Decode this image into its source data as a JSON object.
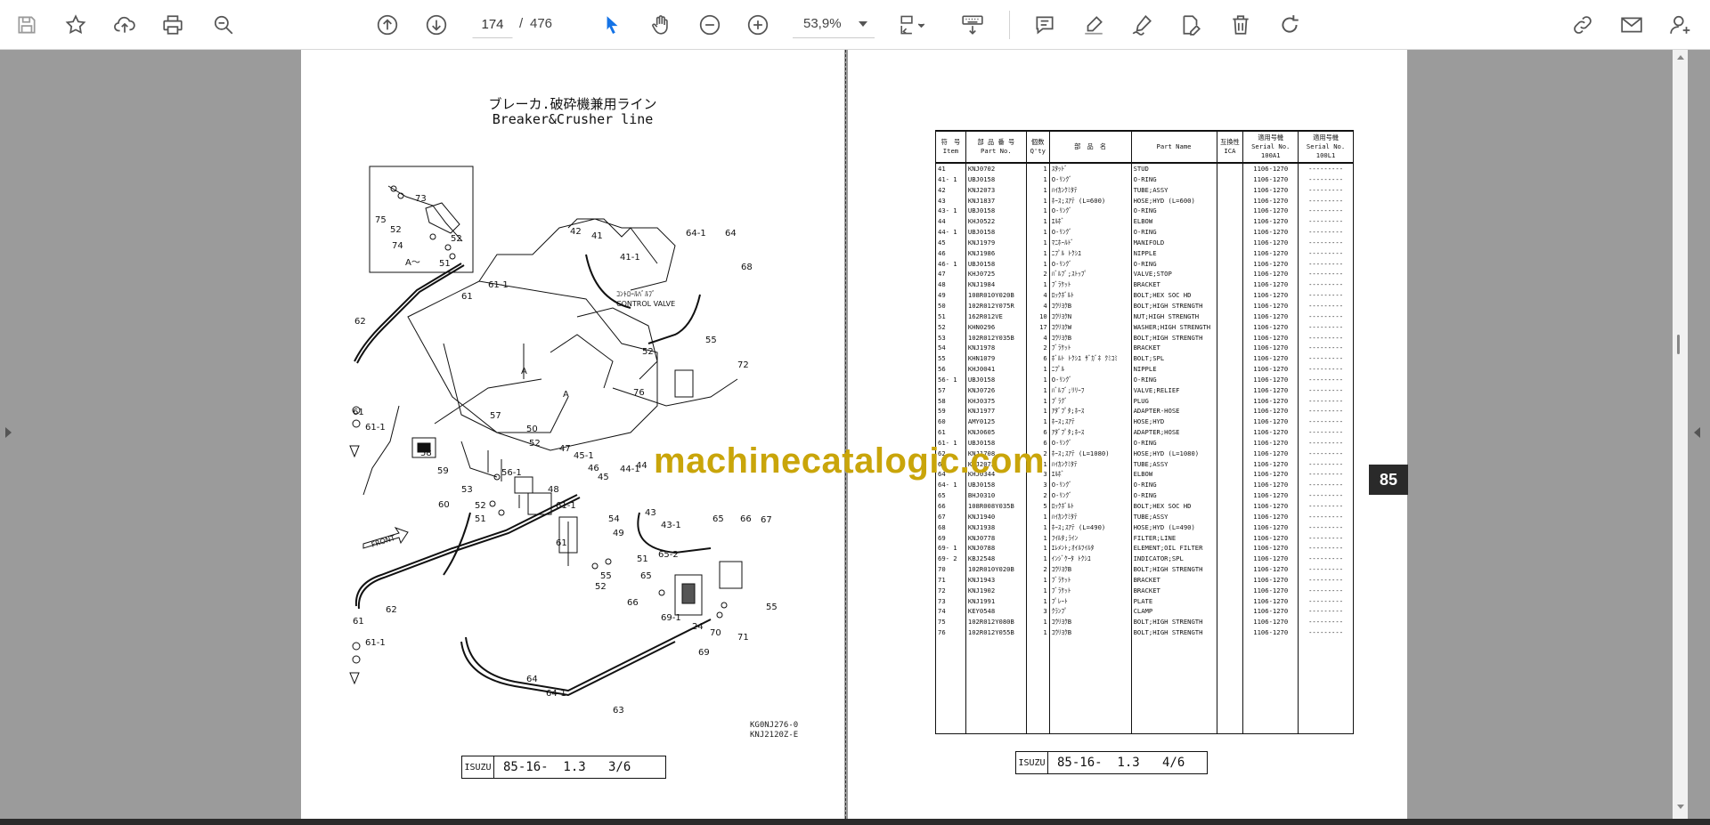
{
  "toolbar": {
    "page_current": "174",
    "page_separator": "/",
    "page_total": "476",
    "zoom": "53,9%",
    "accent_color": "#1473e6"
  },
  "left_page": {
    "title_jp": "ブレーカ.破砕機兼用ライン",
    "title_en": "Breaker&Crusher line",
    "control_valve_jp": "ｺﾝﾄﾛｰﾙﾊﾞﾙﾌﾞ",
    "control_valve_en": "CONTROL VALVE",
    "inset_label": "A～",
    "front_label": "FRONT",
    "ref_code_1": "KG0NJ276-0",
    "ref_code_2": "KNJ2120Z-E",
    "footer_logo": "ISUZU",
    "footer_text": "85-16-  1.3   3/6"
  },
  "right_page": {
    "headers": {
      "item_jp": "符　号",
      "item_en": "Item",
      "pn_jp": "部 品 番 号",
      "pn_en": "Part No.",
      "qty_jp": "個数",
      "qty_en": "Q'ty",
      "name_jp": "部　品　名",
      "name_en": "Part Name",
      "ica_jp": "互換性",
      "ica_en": "ICA",
      "s1_jp": "適用号機",
      "s1_en": "Serial No.",
      "s1_code": "100A1",
      "s2_jp": "適用号機",
      "s2_en": "Serial No.",
      "s2_code": "100L1"
    },
    "rows": [
      [
        "41",
        "KNJ0702",
        "1",
        "ｽﾀｯﾄﾞ",
        "STUD",
        "",
        "1106-1270",
        "---------"
      ],
      [
        "41- 1",
        "UBJ0158",
        "1",
        "O-ﾘﾝｸﾞ",
        "O-RING",
        "",
        "1106-1270",
        "---------"
      ],
      [
        "42",
        "KNJ2073",
        "1",
        "ﾊｲｶﾝｸﾐﾀﾃ",
        "TUBE;ASSY",
        "",
        "1106-1270",
        "---------"
      ],
      [
        "43",
        "KNJ1837",
        "1",
        "ﾎｰｽ;ｽｱﾃ (L=600)",
        "HOSE;HYD (L=600)",
        "",
        "1106-1270",
        "---------"
      ],
      [
        "43- 1",
        "UBJ0158",
        "1",
        "O-ﾘﾝｸﾞ",
        "O-RING",
        "",
        "1106-1270",
        "---------"
      ],
      [
        "44",
        "KHJ0522",
        "1",
        "ｴﾙﾎﾞ",
        "ELBOW",
        "",
        "1106-1270",
        "---------"
      ],
      [
        "44- 1",
        "UBJ0158",
        "1",
        "O-ﾘﾝｸﾞ",
        "O-RING",
        "",
        "1106-1270",
        "---------"
      ],
      [
        "45",
        "KNJ1979",
        "1",
        "ﾏﾆﾎｰﾙﾄﾞ",
        "MANIFOLD",
        "",
        "1106-1270",
        "---------"
      ],
      [
        "46",
        "KNJ1986",
        "1",
        "ﾆﾌﾟﾙ ﾄｸｼﾕ",
        "NIPPLE",
        "",
        "1106-1270",
        "---------"
      ],
      [
        "46- 1",
        "UBJ0158",
        "1",
        "O-ﾘﾝｸﾞ",
        "O-RING",
        "",
        "1106-1270",
        "---------"
      ],
      [
        "47",
        "KHJ0725",
        "2",
        "ﾊﾞﾙﾌﾞ;ｽﾄｯﾌﾟ",
        "VALVE;STOP",
        "",
        "1106-1270",
        "---------"
      ],
      [
        "48",
        "KNJ1984",
        "1",
        "ﾌﾞﾗｹｯﾄ",
        "BRACKET",
        "",
        "1106-1270",
        "---------"
      ],
      [
        "49",
        "108R010Y020B",
        "4",
        "ﾛｯｸﾎﾞﾙﾄ",
        "BOLT;HEX SOC HD",
        "",
        "1106-1270",
        "---------"
      ],
      [
        "50",
        "102R012Y075R",
        "4",
        "ｺｳﾘﾖｸB",
        "BOLT;HIGH STRENGTH",
        "",
        "1106-1270",
        "---------"
      ],
      [
        "51",
        "162R012VE",
        "10",
        "ｺｳﾘﾖｸN",
        "NUT;HIGH STRENGTH",
        "",
        "1106-1270",
        "---------"
      ],
      [
        "52",
        "KHN0296",
        "17",
        "ｺｳﾘﾖｸW",
        "WASHER;HIGH STRENGTH",
        "",
        "1106-1270",
        "---------"
      ],
      [
        "53",
        "102R012Y035B",
        "4",
        "ｺｳﾘﾖｸB",
        "BOLT;HIGH STRENGTH",
        "",
        "1106-1270",
        "---------"
      ],
      [
        "54",
        "KNJ1978",
        "2",
        "ﾌﾞﾗｹｯﾄ",
        "BRACKET",
        "",
        "1106-1270",
        "---------"
      ],
      [
        "55",
        "KHN1079",
        "6",
        "ﾎﾞﾙﾄ ﾄｸｼﾕ ｻﾞｶﾞﾈ ｸﾐｺﾐ",
        "BOLT;SPL",
        "",
        "1106-1270",
        "---------"
      ],
      [
        "56",
        "KHJ0041",
        "1",
        "ﾆﾌﾟﾙ",
        "NIPPLE",
        "",
        "1106-1270",
        "---------"
      ],
      [
        "56- 1",
        "UBJ0158",
        "1",
        "O-ﾘﾝｸﾞ",
        "O-RING",
        "",
        "1106-1270",
        "---------"
      ],
      [
        "57",
        "KNJ0726",
        "1",
        "ﾊﾞﾙﾌﾞ;ﾘﾘｰﾌ",
        "VALVE;RELIEF",
        "",
        "1106-1270",
        "---------"
      ],
      [
        "58",
        "KHJ0375",
        "1",
        "ﾌﾟﾗｸﾞ",
        "PLUG",
        "",
        "1106-1270",
        "---------"
      ],
      [
        "59",
        "KNJ1977",
        "1",
        "ｱﾀﾞﾌﾟﾀ;ﾎｰｽ",
        "ADAPTER-HOSE",
        "",
        "1106-1270",
        "---------"
      ],
      [
        "60",
        "AMY0125",
        "1",
        "ﾎｰｽ;ｽｱﾃ",
        "HOSE;HYD",
        "",
        "1106-1270",
        "---------"
      ],
      [
        "61",
        "KNJ0605",
        "6",
        "ｱﾀﾞﾌﾟﾀ;ﾎｰｽ",
        "ADAPTER;HOSE",
        "",
        "1106-1270",
        "---------"
      ],
      [
        "61- 1",
        "UBJ0158",
        "6",
        "O-ﾘﾝｸﾞ",
        "O-RING",
        "",
        "1106-1270",
        "---------"
      ],
      [
        "62",
        "KNJ1708",
        "2",
        "ﾎｰｽ;ｽｱﾃ (L=1080)",
        "HOSE;HYD (L=1080)",
        "",
        "1106-1270",
        "---------"
      ],
      [
        "63",
        "KNJ2072",
        "1",
        "ﾊｲｶﾝｸﾐﾀﾃ",
        "TUBE;ASSY",
        "",
        "1106-1270",
        "---------"
      ],
      [
        "64",
        "KHJ0344",
        "3",
        "ｴﾙﾎﾞ",
        "ELBOW",
        "",
        "1106-1270",
        "---------"
      ],
      [
        "64- 1",
        "UBJ0158",
        "3",
        "O-ﾘﾝｸﾞ",
        "O-RING",
        "",
        "1106-1270",
        "---------"
      ],
      [
        "65",
        "BHJ0310",
        "2",
        "O-ﾘﾝｸﾞ",
        "O-RING",
        "",
        "1106-1270",
        "---------"
      ],
      [
        "66",
        "108R008Y035B",
        "5",
        "ﾛｯｸﾎﾞﾙﾄ",
        "BOLT;HEX SOC HD",
        "",
        "1106-1270",
        "---------"
      ],
      [
        "67",
        "KNJ1940",
        "1",
        "ﾊｲｶﾝｸﾐﾀﾃ",
        "TUBE;ASSY",
        "",
        "1106-1270",
        "---------"
      ],
      [
        "68",
        "KNJ1938",
        "1",
        "ﾎｰｽ;ｽｱﾃ (L=490)",
        "HOSE;HYD (L=490)",
        "",
        "1106-1270",
        "---------"
      ],
      [
        "69",
        "KNJ0778",
        "1",
        "ﾌｲﾙﾀ;ﾗｲﾝ",
        "FILTER;LINE",
        "",
        "1106-1270",
        "---------"
      ],
      [
        "69- 1",
        "KNJ0788",
        "1",
        "ｴﾚﾒﾝﾄ;ｵｲﾙﾌｲﾙﾀ",
        "ELEMENT;OIL FILTER",
        "",
        "1106-1270",
        "---------"
      ],
      [
        "69- 2",
        "KBJ2548",
        "1",
        "ｲﾝｼﾞｹｰﾀ ﾄｸｼﾕ",
        "INDICATOR;SPL",
        "",
        "1106-1270",
        "---------"
      ],
      [
        "70",
        "102R010Y020B",
        "2",
        "ｺｳﾘﾖｸB",
        "BOLT;HIGH STRENGTH",
        "",
        "1106-1270",
        "---------"
      ],
      [
        "71",
        "KNJ1943",
        "1",
        "ﾌﾞﾗｹｯﾄ",
        "BRACKET",
        "",
        "1106-1270",
        "---------"
      ],
      [
        "72",
        "KNJ1902",
        "1",
        "ﾌﾞﾗｹｯﾄ",
        "BRACKET",
        "",
        "1106-1270",
        "---------"
      ],
      [
        "73",
        "KNJ1991",
        "1",
        "ﾌﾟﾚｰﾄ",
        "PLATE",
        "",
        "1106-1270",
        "---------"
      ],
      [
        "74",
        "KEY0548",
        "3",
        "ｸﾗﾝﾌﾟ",
        "CLAMP",
        "",
        "1106-1270",
        "---------"
      ],
      [
        "75",
        "102R012Y080B",
        "1",
        "ｺｳﾘﾖｸB",
        "BOLT;HIGH STRENGTH",
        "",
        "1106-1270",
        "---------"
      ],
      [
        "76",
        "102R012Y055B",
        "1",
        "ｺｳﾘﾖｸB",
        "BOLT;HIGH STRENGTH",
        "",
        "1106-1270",
        "---------"
      ]
    ],
    "footer_logo": "ISUZU",
    "footer_text": "85-16-  1.3   4/6"
  },
  "watermark": "machinecatalogic.com",
  "page_badge": "85"
}
